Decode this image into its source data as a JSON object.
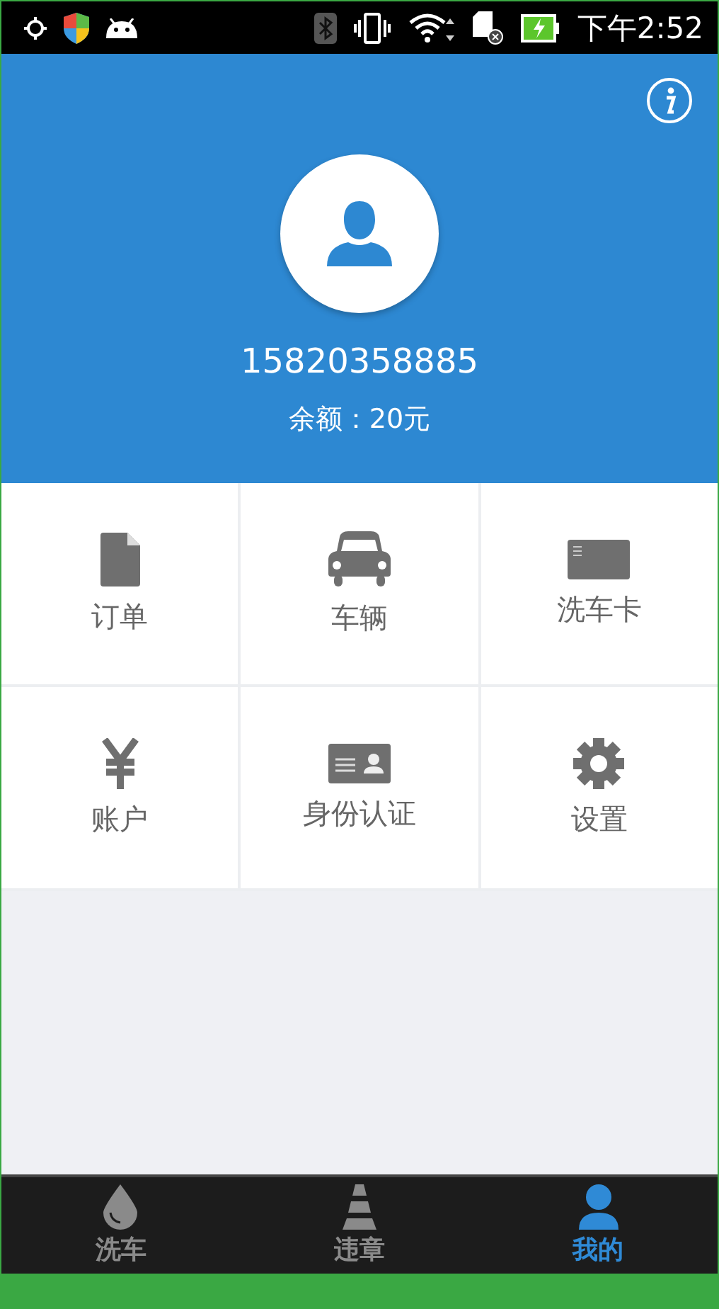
{
  "status_bar": {
    "time": "下午2:52"
  },
  "profile": {
    "phone": "15820358885",
    "balance": "余额：20元"
  },
  "menu": [
    {
      "kind": "order",
      "label": "订单"
    },
    {
      "kind": "vehicle",
      "label": "车辆"
    },
    {
      "kind": "card",
      "label": "洗车卡"
    },
    {
      "kind": "account",
      "label": "账户"
    },
    {
      "kind": "identity",
      "label": "身份认证"
    },
    {
      "kind": "settings",
      "label": "设置"
    }
  ],
  "bottom_nav": [
    {
      "kind": "wash",
      "label": "洗车",
      "selected": false
    },
    {
      "kind": "violation",
      "label": "违章",
      "selected": false
    },
    {
      "kind": "mine",
      "label": "我的",
      "selected": true
    }
  ]
}
